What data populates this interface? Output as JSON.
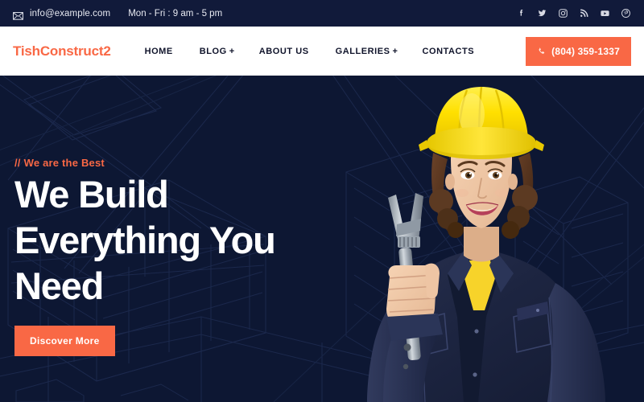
{
  "topbar": {
    "email_icon": "envelope-icon",
    "email": "info@example.com",
    "hours": "Mon - Fri : 9 am - 5 pm",
    "socials": [
      {
        "name": "facebook-icon",
        "label": "Facebook"
      },
      {
        "name": "twitter-icon",
        "label": "Twitter"
      },
      {
        "name": "instagram-icon",
        "label": "Instagram"
      },
      {
        "name": "rss-icon",
        "label": "RSS"
      },
      {
        "name": "youtube-icon",
        "label": "YouTube"
      },
      {
        "name": "pinterest-icon",
        "label": "Pinterest"
      }
    ],
    "background_color": "#111a3a"
  },
  "nav": {
    "logo": "TishConstruct2",
    "logo_color": "#f96845",
    "background_color": "#ffffff",
    "items": [
      {
        "label": "HOME",
        "has_submenu": false,
        "plus": ""
      },
      {
        "label": "BLOG",
        "has_submenu": true,
        "plus": "+"
      },
      {
        "label": "ABOUT US",
        "has_submenu": false,
        "plus": ""
      },
      {
        "label": "GALLERIES",
        "has_submenu": true,
        "plus": "+"
      },
      {
        "label": "CONTACTS",
        "has_submenu": false,
        "plus": ""
      }
    ],
    "phone": {
      "icon": "phone-icon",
      "number": "(804) 359-1337",
      "background_color": "#f96845"
    }
  },
  "hero": {
    "background_color": "#0d1733",
    "eyebrow_slashes": "//",
    "eyebrow": "We are the Best",
    "eyebrow_color": "#f96845",
    "headline": "We Build Everything You Need",
    "headline_color": "#ffffff",
    "cta_label": "Discover More",
    "cta_color": "#f96845",
    "image_alt": "female-construction-worker-with-yellow-hard-hat-holding-wrench",
    "background_art": "architectural-blueprint-wireframe"
  }
}
